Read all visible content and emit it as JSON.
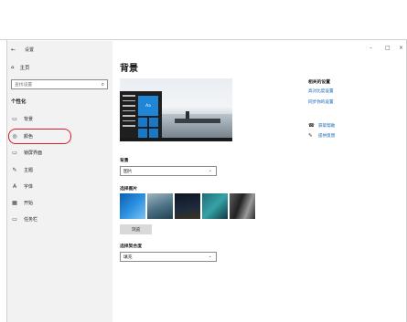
{
  "window": {
    "back_label": "设置",
    "controls": [
      "–",
      "□",
      "×"
    ]
  },
  "sidebar": {
    "home_label": "主页",
    "search_placeholder": "查找设置",
    "section_title": "个性化",
    "items": [
      {
        "icon": "image-icon",
        "glyph": "▭",
        "label": "背景"
      },
      {
        "icon": "palette-icon",
        "glyph": "◎",
        "label": "颜色"
      },
      {
        "icon": "lock-screen-icon",
        "glyph": "▭",
        "label": "锁屏界面"
      },
      {
        "icon": "theme-icon",
        "glyph": "✎",
        "label": "主题"
      },
      {
        "icon": "font-icon",
        "glyph": "A",
        "label": "字体"
      },
      {
        "icon": "start-icon",
        "glyph": "▦",
        "label": "开始"
      },
      {
        "icon": "taskbar-icon",
        "glyph": "▭",
        "label": "任务栏"
      }
    ]
  },
  "main": {
    "title": "背景",
    "preview_tile_text": "Aa",
    "background_label": "背景",
    "background_value": "图片",
    "choose_picture_label": "选择图片",
    "browse_label": "浏览",
    "fit_label": "选择契合度",
    "fit_value": "填充"
  },
  "related": {
    "heading": "相关的设置",
    "links": [
      "高对比度设置",
      "同步你的设置"
    ],
    "help_label": "获取帮助",
    "feedback_label": "提供反馈"
  },
  "colors": {
    "accent": "#0a63b8",
    "highlight": "#d81e2a"
  }
}
